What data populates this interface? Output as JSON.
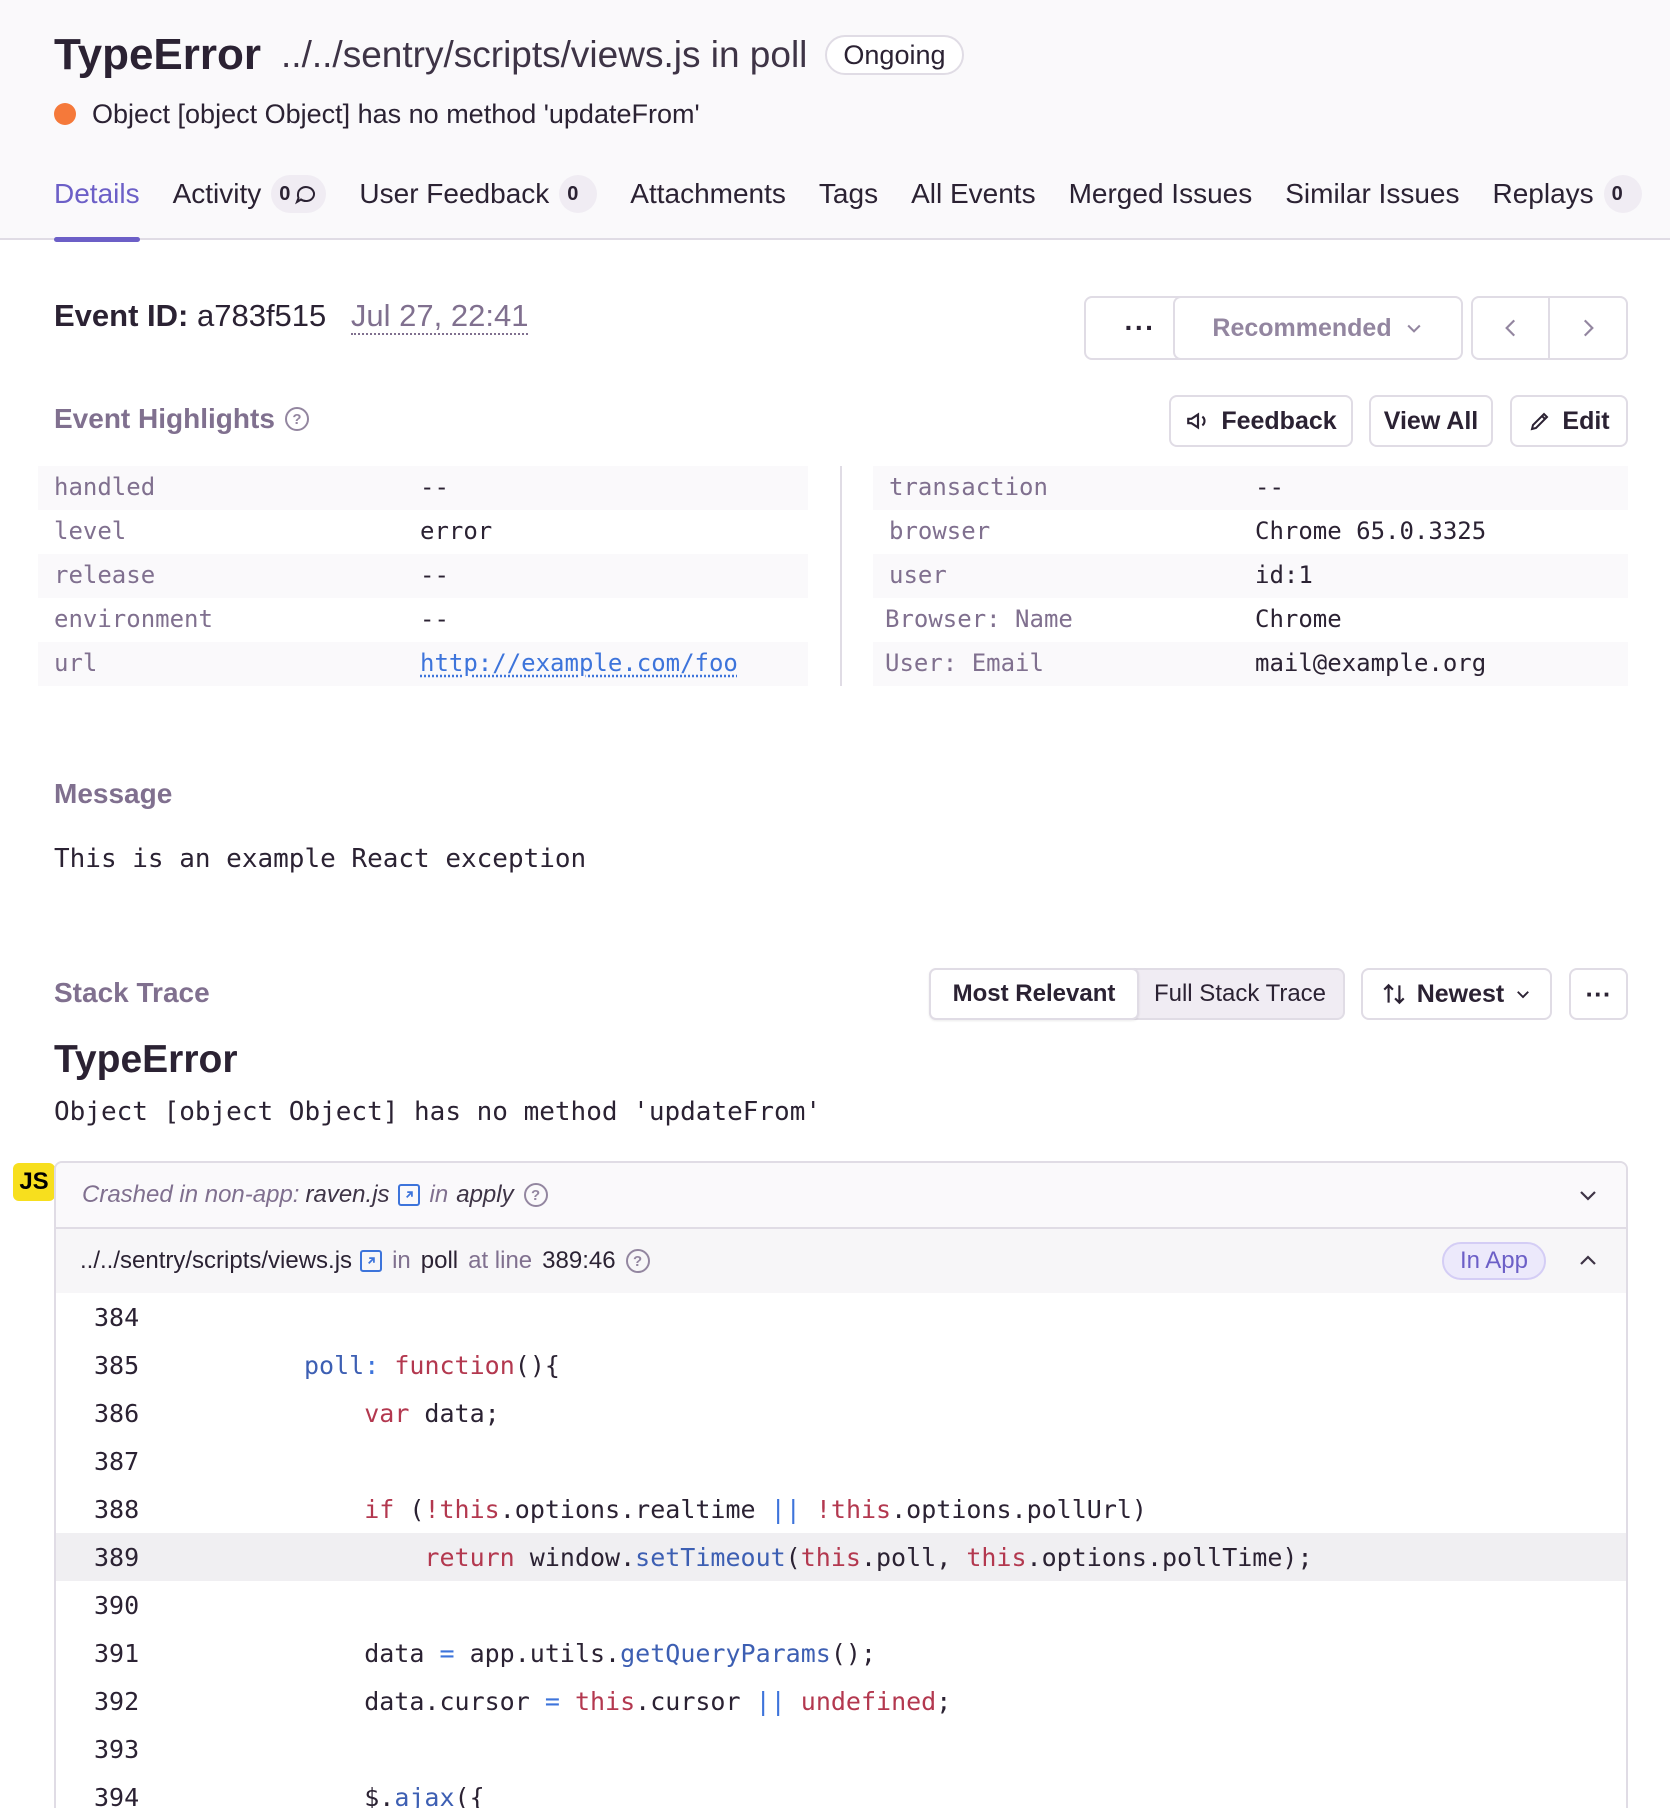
{
  "issue": {
    "type": "TypeError",
    "location": "../../sentry/scripts/views.js in poll",
    "status": "Ongoing",
    "message": "Object [object Object] has no method 'updateFrom'",
    "status_color": "#f5793a"
  },
  "tabs": [
    {
      "label": "Details",
      "active": true
    },
    {
      "label": "Activity",
      "count": "0"
    },
    {
      "label": "User Feedback",
      "count": "0"
    },
    {
      "label": "Attachments"
    },
    {
      "label": "Tags"
    },
    {
      "label": "All Events"
    },
    {
      "label": "Merged Issues"
    },
    {
      "label": "Similar Issues"
    },
    {
      "label": "Replays",
      "count": "0"
    }
  ],
  "event": {
    "id_label": "Event ID:",
    "id": "a783f515",
    "date": "Jul 27, 22:41",
    "more_label": "···",
    "recommended_label": "Recommended"
  },
  "highlights": {
    "title": "Event Highlights",
    "feedback_label": "Feedback",
    "view_all_label": "View All",
    "edit_label": "Edit",
    "left": [
      {
        "key": "handled",
        "value": "--"
      },
      {
        "key": "level",
        "value": "error"
      },
      {
        "key": "release",
        "value": "--"
      },
      {
        "key": "environment",
        "value": "--"
      },
      {
        "key": "url",
        "value": "http://example.com/foo"
      }
    ],
    "right": [
      {
        "key": "transaction",
        "value": "--"
      },
      {
        "key": "browser",
        "value": "Chrome 65.0.3325"
      },
      {
        "key": "user",
        "value": "id:1"
      },
      {
        "key": "Browser: Name",
        "value": "Chrome"
      },
      {
        "key": "User: Email",
        "value": "mail@example.org"
      }
    ]
  },
  "message": {
    "title": "Message",
    "text": "This is an example React exception"
  },
  "stack_trace": {
    "title": "Stack Trace",
    "view_options": [
      "Most Relevant",
      "Full Stack Trace"
    ],
    "sort_label": "Newest",
    "more_label": "···",
    "exception_type": "TypeError",
    "exception_message": "Object [object Object] has no method 'updateFrom'",
    "platform_badge": "JS",
    "crashed_prefix": "Crashed in non-app:",
    "crashed_file": "raven.js",
    "crashed_in": "in",
    "crashed_fn": "apply",
    "frame": {
      "file": "../../sentry/scripts/views.js",
      "in": "in",
      "fn": "poll",
      "at_line": "at line",
      "lineno": "389:46",
      "in_app": "In App"
    },
    "code_lines": [
      {
        "n": "384",
        "code": ""
      },
      {
        "n": "385",
        "code": "poll: function(){"
      },
      {
        "n": "386",
        "code": "    var data;"
      },
      {
        "n": "387",
        "code": ""
      },
      {
        "n": "388",
        "code": "    if (!this.options.realtime || !this.options.pollUrl)"
      },
      {
        "n": "389",
        "code": "        return window.setTimeout(this.poll, this.options.pollTime);"
      },
      {
        "n": "390",
        "code": ""
      },
      {
        "n": "391",
        "code": "    data = app.utils.getQueryParams();"
      },
      {
        "n": "392",
        "code": "    data.cursor = this.cursor || undefined;"
      },
      {
        "n": "393",
        "code": ""
      },
      {
        "n": "394",
        "code": "    $.ajax({"
      }
    ]
  }
}
